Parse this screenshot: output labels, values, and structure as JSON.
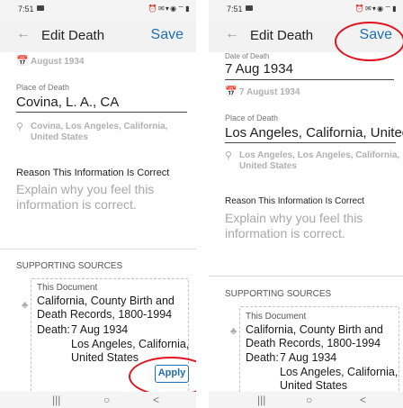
{
  "status_bar": {
    "time": "7:51",
    "icons": "⏰ ✉ ▾ ◉ ⌔ ▮"
  },
  "toolbar": {
    "back_icon": "←",
    "title": "Edit Death",
    "save_label": "Save"
  },
  "left_screen": {
    "date_standardized": "August 1934",
    "place_label": "Place of Death",
    "place_value": "Covina, L. A., CA",
    "place_standardized": "Covina, Los Angeles, California, United States",
    "reason_label": "Reason This Information Is Correct",
    "reason_placeholder": "Explain why you feel this information is correct.",
    "sources_header": "SUPPORTING SOURCES",
    "source": {
      "doc_label": "This Document",
      "title": "California, County Birth and Death Records, 1800-1994",
      "death_label": "Death:",
      "death_date": "7 Aug 1934",
      "death_place": "Los Angeles, California, United States"
    },
    "apply_label": "Apply"
  },
  "right_screen": {
    "date_label": "Date of Death",
    "date_value": "7 Aug 1934",
    "date_standardized": "7 August 1934",
    "place_label": "Place of Death",
    "place_value": "Los Angeles, California, United",
    "place_standardized": "Los Angeles, Los Angeles, California, United States",
    "reason_label": "Reason This Information Is Correct",
    "reason_placeholder": "Explain why you feel this information is correct.",
    "sources_header": "SUPPORTING SOURCES",
    "source": {
      "doc_label": "This Document",
      "title": "California, County Birth and Death Records, 1800-1994",
      "death_label": "Death:",
      "death_date": "7 Aug 1934",
      "death_place": "Los Angeles, California, United States"
    }
  },
  "nav_bar": {
    "recents": "|||",
    "home": "○",
    "back": "<"
  },
  "colors": {
    "accent": "#1e6fb0",
    "annotation": "#e0141e",
    "hint": "#b0b0b0"
  }
}
